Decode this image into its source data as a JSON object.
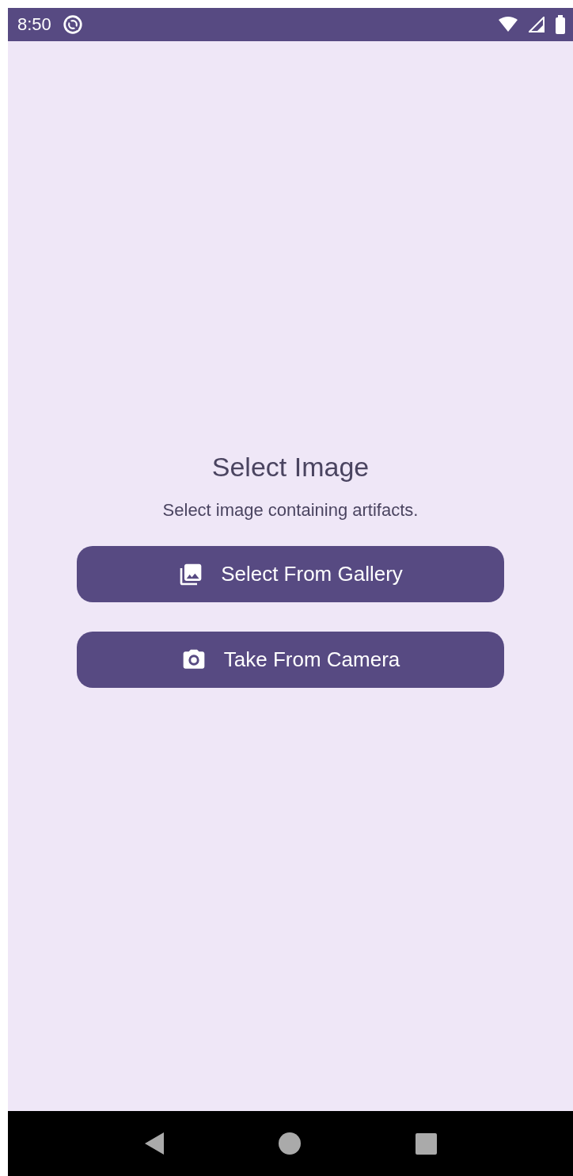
{
  "status_bar": {
    "time": "8:50"
  },
  "title": "Select Image",
  "subtitle": "Select image containing artifacts.",
  "buttons": [
    {
      "label": "Select From Gallery",
      "kind": "gallery"
    },
    {
      "label": "Take From Camera",
      "kind": "camera"
    }
  ]
}
